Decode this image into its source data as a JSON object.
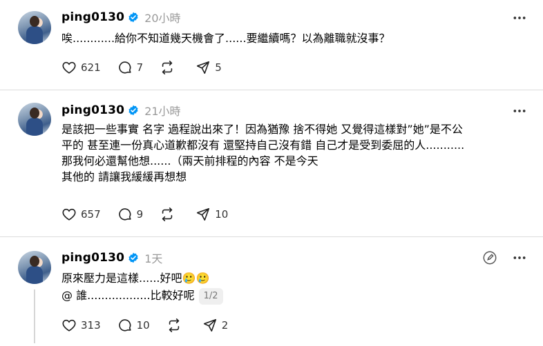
{
  "posts": [
    {
      "username": "ping0130",
      "time": "20小時",
      "lines": [
        "唉............給你不知道幾天機會了......要繼續嗎？以為離職就沒事？"
      ],
      "page_badge": "",
      "stats": {
        "likes": "621",
        "replies": "7",
        "reposts": "",
        "shares": "5"
      }
    },
    {
      "username": "ping0130",
      "time": "21小時",
      "lines": [
        "是該把一些事實 名字 過程說出來了！因為猶豫 捨不得她 又覺得這樣對”她”是不公",
        "平的 甚至連一份真心道歉都沒有 還堅持自己沒有錯 自己才是受到委屈的人...........",
        "那我何必還幫他想......（兩天前排程的內容 不是今天",
        "其他的 請讓我緩緩再想想"
      ],
      "page_badge": "",
      "stats": {
        "likes": "657",
        "replies": "9",
        "reposts": "",
        "shares": "10"
      }
    },
    {
      "username": "ping0130",
      "time": "1天",
      "lines": [
        "原來壓力是這樣......好吧🥲🥲",
        "@ 誰..................比較好呢"
      ],
      "page_badge": "1/2",
      "stats": {
        "likes": "313",
        "replies": "10",
        "reposts": "",
        "shares": "2"
      }
    }
  ],
  "icons": {
    "verified_color": "#0095f6",
    "names": [
      "verified-icon",
      "more-icon",
      "edit-icon",
      "heart-icon",
      "comment-icon",
      "repost-icon",
      "share-icon"
    ]
  }
}
